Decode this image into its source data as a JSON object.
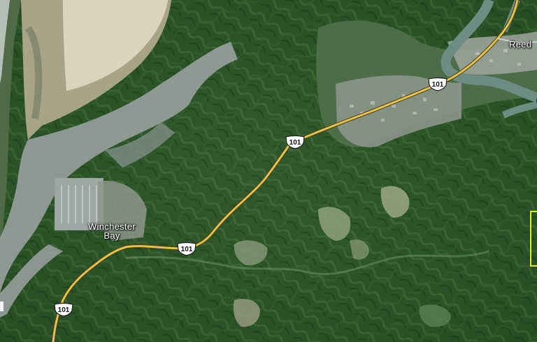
{
  "map": {
    "type": "satellite",
    "places": [
      {
        "id": "winchester-bay",
        "name": "Winchester\nBay"
      },
      {
        "id": "reedsport",
        "name": "Reed"
      }
    ],
    "highway": {
      "route": "101",
      "color": "#f1c232",
      "casing": "#3b3b3b"
    },
    "shields": [
      {
        "id": "shield-101-a",
        "label": "101"
      },
      {
        "id": "shield-101-b",
        "label": "101"
      },
      {
        "id": "shield-101-c",
        "label": "101"
      },
      {
        "id": "shield-101-d",
        "label": "101"
      }
    ],
    "colors": {
      "forest": "#2f5a2b",
      "forest_light": "#4f7a45",
      "water": "#8d9a94",
      "sand": "#d8cfbb",
      "town": "#9aa39a",
      "boundary": "#e8e81a"
    }
  }
}
